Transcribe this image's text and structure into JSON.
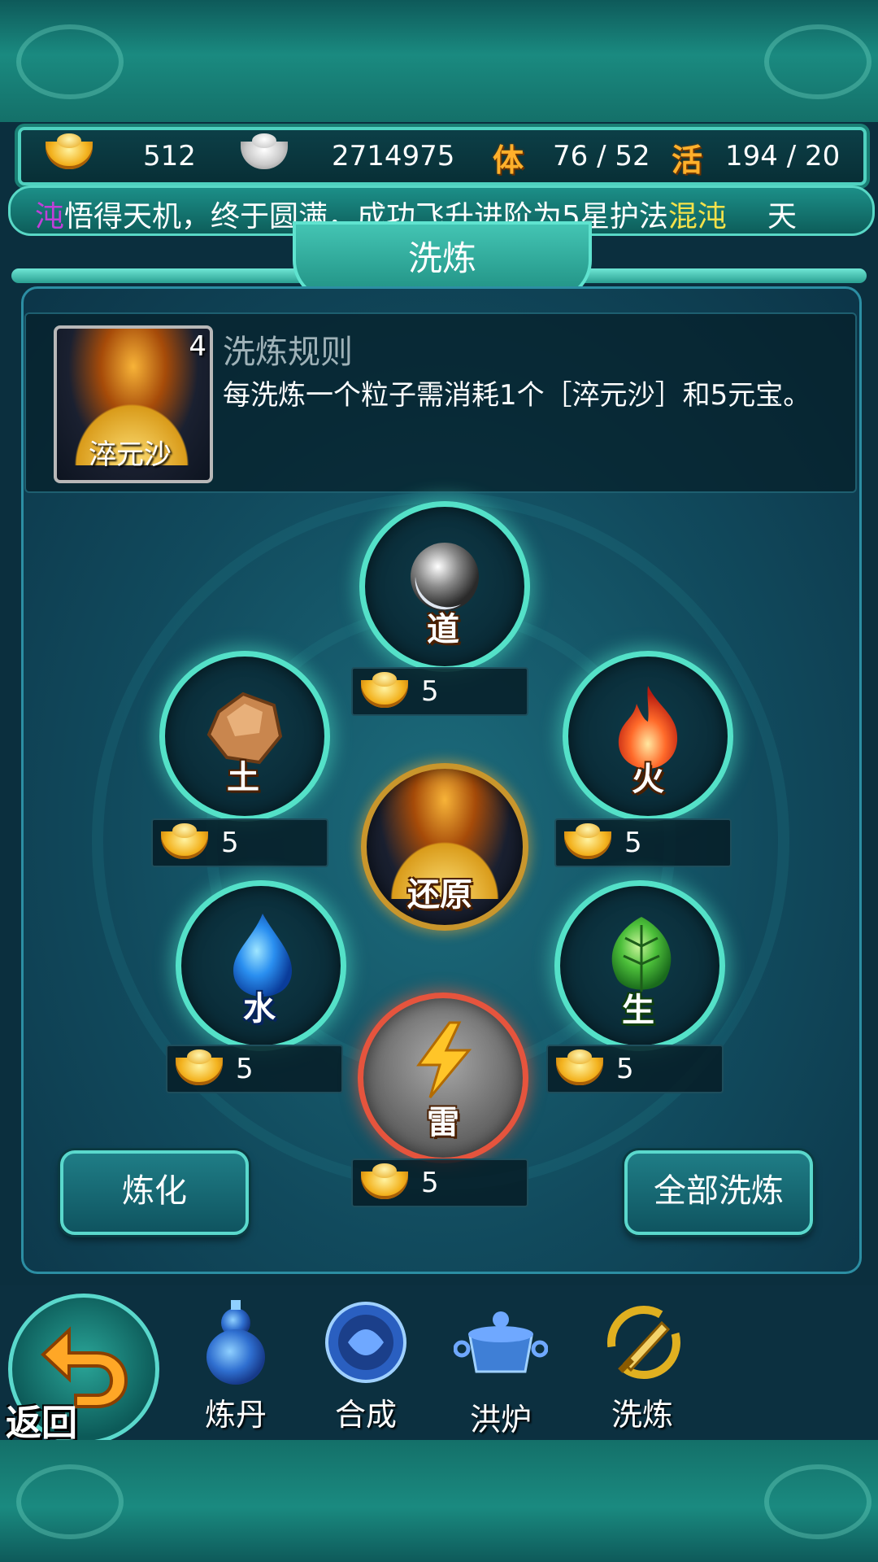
{
  "resources": {
    "gold": "512",
    "silver": "2714975",
    "stamina_icon": "体",
    "stamina": "76 / 52",
    "vitality_icon": "活",
    "vitality": "194 / 20"
  },
  "marquee": {
    "prefix": "沌",
    "message": "悟得天机，终于圆满，成功飞升进阶为5星护法",
    "highlight": "混沌",
    "suffix": "天"
  },
  "title": "洗炼",
  "rule": {
    "item_name": "淬元沙",
    "item_count": "4",
    "title": "洗炼规则",
    "description": "每洗炼一个粒子需消耗1个［淬元沙］和5元宝。"
  },
  "particles": [
    {
      "id": "dao",
      "label": "道",
      "cost": "5",
      "icon": "dao-orb-icon"
    },
    {
      "id": "tu",
      "label": "土",
      "cost": "5",
      "icon": "rock-icon"
    },
    {
      "id": "huo",
      "label": "火",
      "cost": "5",
      "icon": "flame-icon"
    },
    {
      "id": "shui",
      "label": "水",
      "cost": "5",
      "icon": "water-drop-icon"
    },
    {
      "id": "sheng",
      "label": "生",
      "cost": "5",
      "icon": "leaf-icon"
    },
    {
      "id": "lei",
      "label": "雷",
      "cost": "5",
      "icon": "lightning-icon"
    }
  ],
  "center": {
    "label": "还原",
    "icon": "sand-restore-icon"
  },
  "buttons": {
    "refine": "炼化",
    "refine_all": "全部洗炼"
  },
  "nav": {
    "back": "返回",
    "items": [
      {
        "label": "炼丹",
        "icon": "gourd-icon"
      },
      {
        "label": "合成",
        "icon": "merge-emblem-icon"
      },
      {
        "label": "洪炉",
        "icon": "cauldron-icon"
      },
      {
        "label": "洗炼",
        "icon": "refine-sword-icon"
      }
    ]
  },
  "colors": {
    "accent": "#54e1c8",
    "gold": "#f3b21e",
    "highlight": "#f5e24a",
    "panel": "#114a5d",
    "thunder_ring": "#e6543d"
  }
}
